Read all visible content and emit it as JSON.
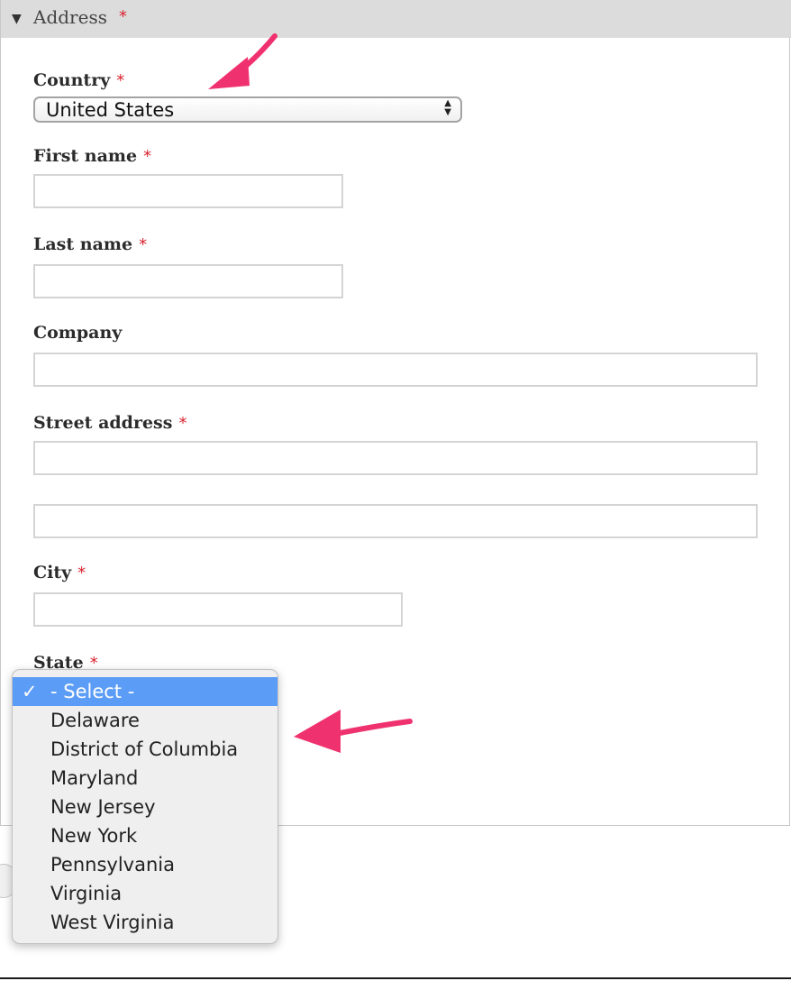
{
  "fieldset": {
    "legend": "Address",
    "required_marker": "*"
  },
  "fields": {
    "country": {
      "label": "Country",
      "required": "*",
      "value": "United States"
    },
    "first_name": {
      "label": "First name",
      "required": "*",
      "value": ""
    },
    "last_name": {
      "label": "Last name",
      "required": "*",
      "value": ""
    },
    "company": {
      "label": "Company",
      "value": ""
    },
    "street_address": {
      "label": "Street address",
      "required": "*",
      "value1": "",
      "value2": ""
    },
    "city": {
      "label": "City",
      "required": "*",
      "value": ""
    },
    "state": {
      "label": "State",
      "required": "*",
      "selected": "- Select -",
      "options": [
        "- Select -",
        "Delaware",
        "District of Columbia",
        "Maryland",
        "New Jersey",
        "New York",
        "Pennsylvania",
        "Virginia",
        "West Virginia"
      ]
    }
  },
  "icons": {
    "collapse": "triangle-down-icon",
    "checkmark": "checkmark-icon",
    "select_arrows": "updown-arrows-icon",
    "annotation": "pink-arrow-icon"
  },
  "colors": {
    "required": "#d9232e",
    "highlight": "#5b9cf6",
    "annotation_arrow": "#f0316f",
    "legend_bg": "#dcdcdc"
  }
}
